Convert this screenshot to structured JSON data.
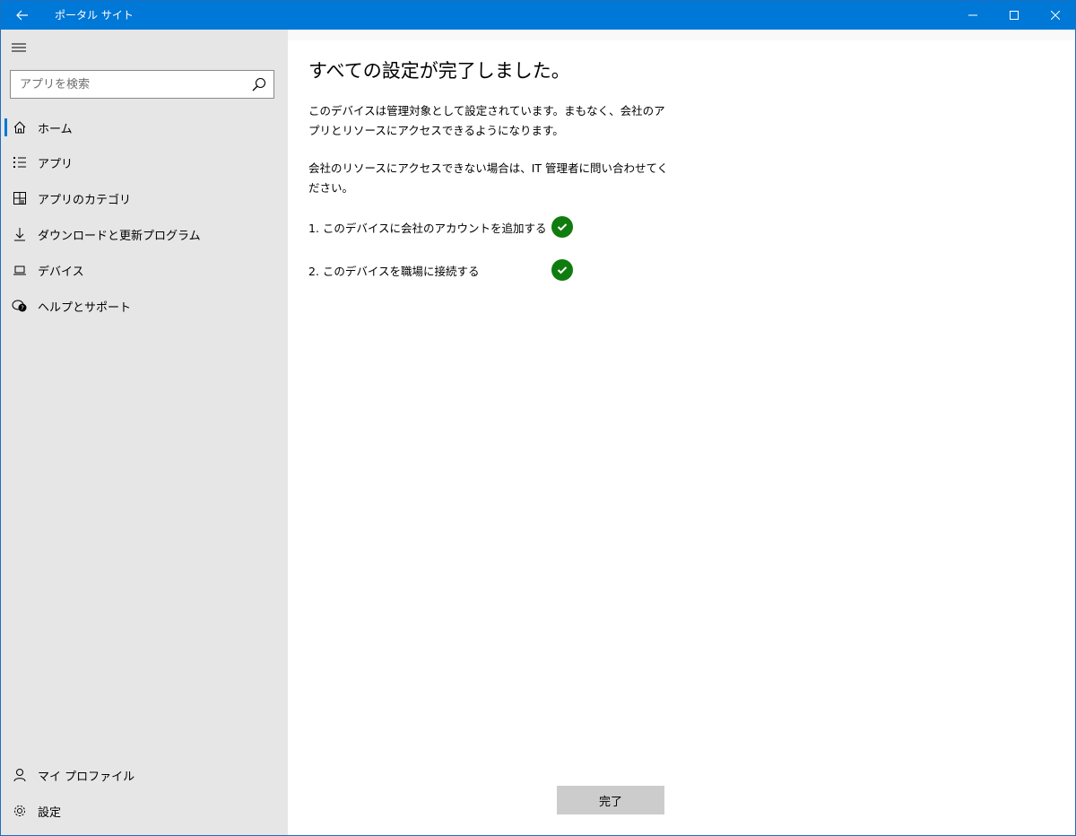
{
  "window": {
    "title": "ポータル サイト"
  },
  "sidebar": {
    "search_placeholder": "アプリを検索",
    "items": [
      {
        "label": "ホーム",
        "icon": "home-icon"
      },
      {
        "label": "アプリ",
        "icon": "list-icon"
      },
      {
        "label": "アプリのカテゴリ",
        "icon": "category-icon"
      },
      {
        "label": "ダウンロードと更新プログラム",
        "icon": "download-icon"
      },
      {
        "label": "デバイス",
        "icon": "device-icon"
      },
      {
        "label": "ヘルプとサポート",
        "icon": "help-icon"
      }
    ],
    "bottom_items": [
      {
        "label": "マイ プロファイル",
        "icon": "person-icon"
      },
      {
        "label": "設定",
        "icon": "gear-icon"
      }
    ]
  },
  "main": {
    "heading": "すべての設定が完了しました。",
    "paragraph1": "このデバイスは管理対象として設定されています。まもなく、会社のアプリとリソースにアクセスできるようになります。",
    "paragraph2": "会社のリソースにアクセスできない場合は、IT 管理者に問い合わせてください。",
    "steps": [
      {
        "label": "1. このデバイスに会社のアカウントを追加する",
        "status": "complete"
      },
      {
        "label": "2. このデバイスを職場に接続する",
        "status": "complete"
      }
    ],
    "done_button": "完了"
  },
  "colors": {
    "titlebar": "#0078d7",
    "sidebar_bg": "#e6e6e6",
    "check_green": "#107c10",
    "button_bg": "#cccccc"
  }
}
